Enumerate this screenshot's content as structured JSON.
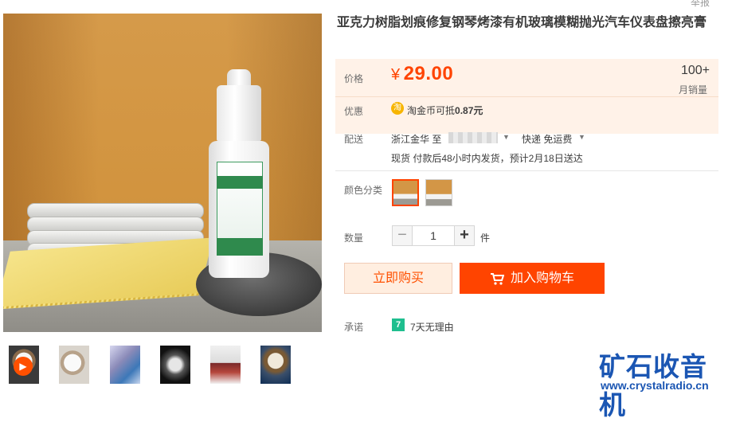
{
  "header": {
    "topright_text": "举报"
  },
  "product": {
    "title": "亚克力树脂划痕修复钢琴烤漆有机玻璃模糊抛光汽车仪表盘擦亮膏"
  },
  "price_section": {
    "price_label": "价格",
    "currency": "¥",
    "price": "29.00",
    "sales_count": "100+",
    "sales_label": "月销量",
    "promo_label": "优惠",
    "coin_icon": "淘",
    "coupon_text": "淘金币可抵",
    "coupon_value": "0.87元"
  },
  "shipping": {
    "label": "配送",
    "from": "浙江金华 至",
    "method": "快递 免运费",
    "note": "现货 付款后48小时内发货，预计2月18日送达"
  },
  "options": {
    "color_label": "颜色分类",
    "quantity_label": "数量",
    "quantity_value": "1",
    "quantity_unit": "件",
    "minus": "−",
    "plus": "+"
  },
  "actions": {
    "buy_now": "立即购买",
    "add_to_cart": "加入购物车"
  },
  "promise": {
    "label": "承诺",
    "icon_text": "7",
    "text": "7天无理由"
  },
  "thumbnails": {
    "play_icon": "▶"
  },
  "watermark": {
    "title": "矿石收音机",
    "url": "www.crystalradio.cn"
  },
  "colors": {
    "accent": "#ff4400",
    "price_bg": "#fff2e8",
    "promise_green": "#1fbf8f",
    "watermark_blue": "#1b56b3"
  }
}
